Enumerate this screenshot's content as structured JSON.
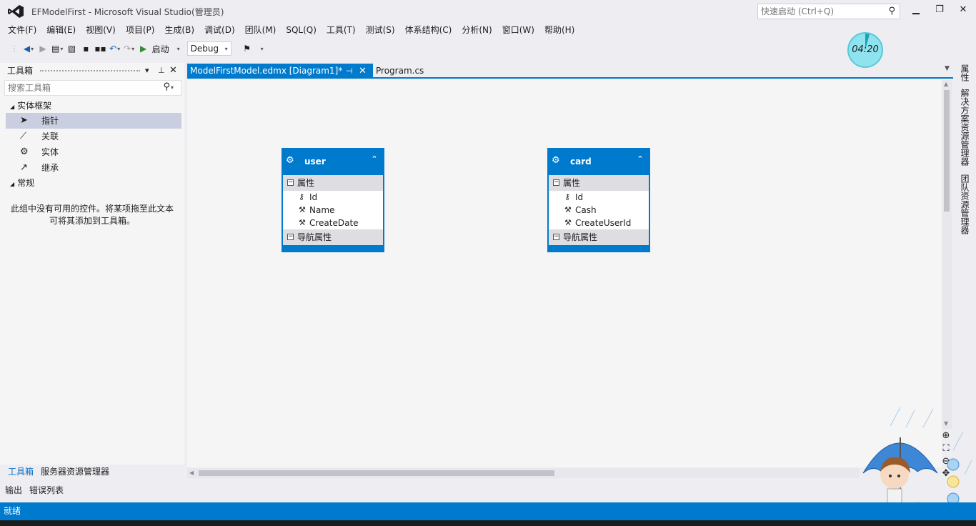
{
  "app": {
    "title": "EFModelFirst - Microsoft Visual Studio(管理员)",
    "quick_launch_placeholder": "快速启动 (Ctrl+Q)",
    "accent_color": "#007ACC"
  },
  "menu": [
    "文件(F)",
    "编辑(E)",
    "视图(V)",
    "项目(P)",
    "生成(B)",
    "调试(D)",
    "团队(M)",
    "SQL(Q)",
    "工具(T)",
    "测试(S)",
    "体系结构(C)",
    "分析(N)",
    "窗口(W)",
    "帮助(H)"
  ],
  "toolbar": {
    "start_label": "启动",
    "config_value": "Debug"
  },
  "timer": "04:20",
  "toolbox": {
    "title": "工具箱",
    "search_placeholder": "搜索工具箱",
    "groups": [
      {
        "label": "实体框架",
        "items": [
          {
            "label": "指针",
            "icon": "pointer-icon"
          },
          {
            "label": "关联",
            "icon": "association-icon"
          },
          {
            "label": "实体",
            "icon": "entity-icon"
          },
          {
            "label": "继承",
            "icon": "inheritance-icon"
          }
        ]
      },
      {
        "label": "常规",
        "items": []
      }
    ],
    "empty_message": "此组中没有可用的控件。将某项拖至此文本可将其添加到工具箱。",
    "bottom_tabs": [
      "工具箱",
      "服务器资源管理器"
    ],
    "output_tabs": [
      "输出",
      "错误列表"
    ]
  },
  "doc_tabs": [
    {
      "label": "ModelFirstModel.edmx [Diagram1]*",
      "active": true
    },
    {
      "label": "Program.cs",
      "active": false
    }
  ],
  "entities": [
    {
      "name": "user",
      "properties_label": "属性",
      "properties": [
        {
          "name": "Id",
          "key": true
        },
        {
          "name": "Name",
          "key": false
        },
        {
          "name": "CreateDate",
          "key": false
        }
      ],
      "nav_label": "导航属性"
    },
    {
      "name": "card",
      "properties_label": "属性",
      "properties": [
        {
          "name": "Id",
          "key": true
        },
        {
          "name": "Cash",
          "key": false
        },
        {
          "name": "CreateUserId",
          "key": false
        }
      ],
      "nav_label": "导航属性"
    }
  ],
  "right_tabs": [
    "属性",
    "解决方案资源管理器",
    "团队资源管理器"
  ],
  "status": "就绪"
}
